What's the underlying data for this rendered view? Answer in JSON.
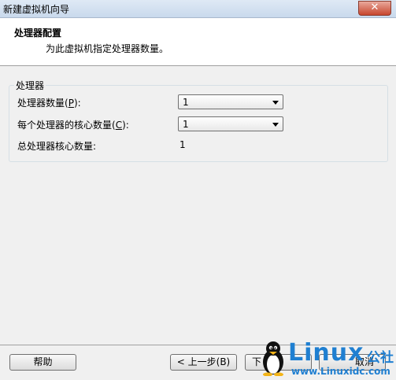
{
  "window": {
    "title": "新建虚拟机向导",
    "close_glyph": "✕"
  },
  "header": {
    "title": "处理器配置",
    "subtitle": "为此虚拟机指定处理器数量。"
  },
  "group": {
    "label": "处理器",
    "processor_count": {
      "label_pre": "处理器数量(",
      "hotkey": "P",
      "label_post": "):",
      "value": "1"
    },
    "cores_per_processor": {
      "label_pre": "每个处理器的核心数量(",
      "hotkey": "C",
      "label_post": "):",
      "value": "1"
    },
    "total_cores": {
      "label": "总处理器核心数量:",
      "value": "1"
    }
  },
  "footer": {
    "help_label": "帮助",
    "back_label": "< 上一步(B)",
    "next_label": "下",
    "cancel_label": "取消"
  },
  "watermark": {
    "brand": "Linux",
    "brand_cn": "公社",
    "url": "www.Linuxidc.com"
  }
}
